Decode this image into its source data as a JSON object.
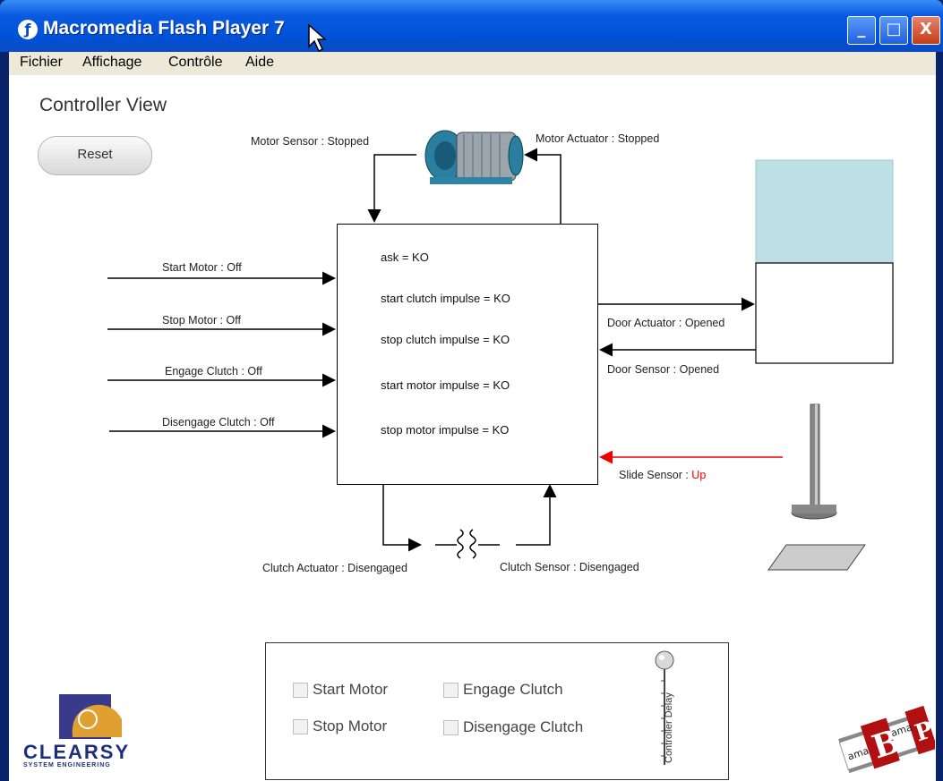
{
  "window": {
    "title": "Macromedia Flash Player 7",
    "buttons": {
      "minimize": "_",
      "maximize": "□",
      "close": "X"
    }
  },
  "menu": [
    "Fichier",
    "Affichage",
    "Contrôle",
    "Aide"
  ],
  "heading": "Controller View",
  "reset_label": "Reset",
  "motor": {
    "sensor_label": "Motor Sensor : Stopped",
    "actuator_label": "Motor Actuator : Stopped"
  },
  "inputs": [
    "Start Motor : Off",
    "Stop Motor : Off",
    "Engage Clutch : Off",
    "Disengage Clutch : Off"
  ],
  "controller_vars": [
    "ask = KO",
    "start clutch impulse = KO",
    "stop clutch impulse = KO",
    "start motor impulse = KO",
    "stop motor impulse = KO"
  ],
  "door": {
    "actuator_label": "Door Actuator : Opened",
    "sensor_label": "Door Sensor : Opened"
  },
  "slide": {
    "label": "Slide Sensor : ",
    "value": "Up",
    "value_color": "#e00000"
  },
  "clutch": {
    "actuator_label": "Clutch Actuator : Disengaged",
    "sensor_label": "Clutch Sensor : Disengaged"
  },
  "panel": {
    "checkboxes": [
      "Start Motor",
      "Engage Clutch",
      "Stop Motor",
      "Disengage Clutch"
    ],
    "slider_label": "Controller Delay",
    "slider_value_fraction": 1.0
  },
  "logos": {
    "clearsy_name": "CLEARSY",
    "clearsy_tagline": "SYSTEM ENGINEERING",
    "brama_text": "ama Brama P"
  },
  "colors": {
    "title_bar": "#0052d6",
    "door_fill": "#bde0e6",
    "slide_line": "#e00000"
  }
}
